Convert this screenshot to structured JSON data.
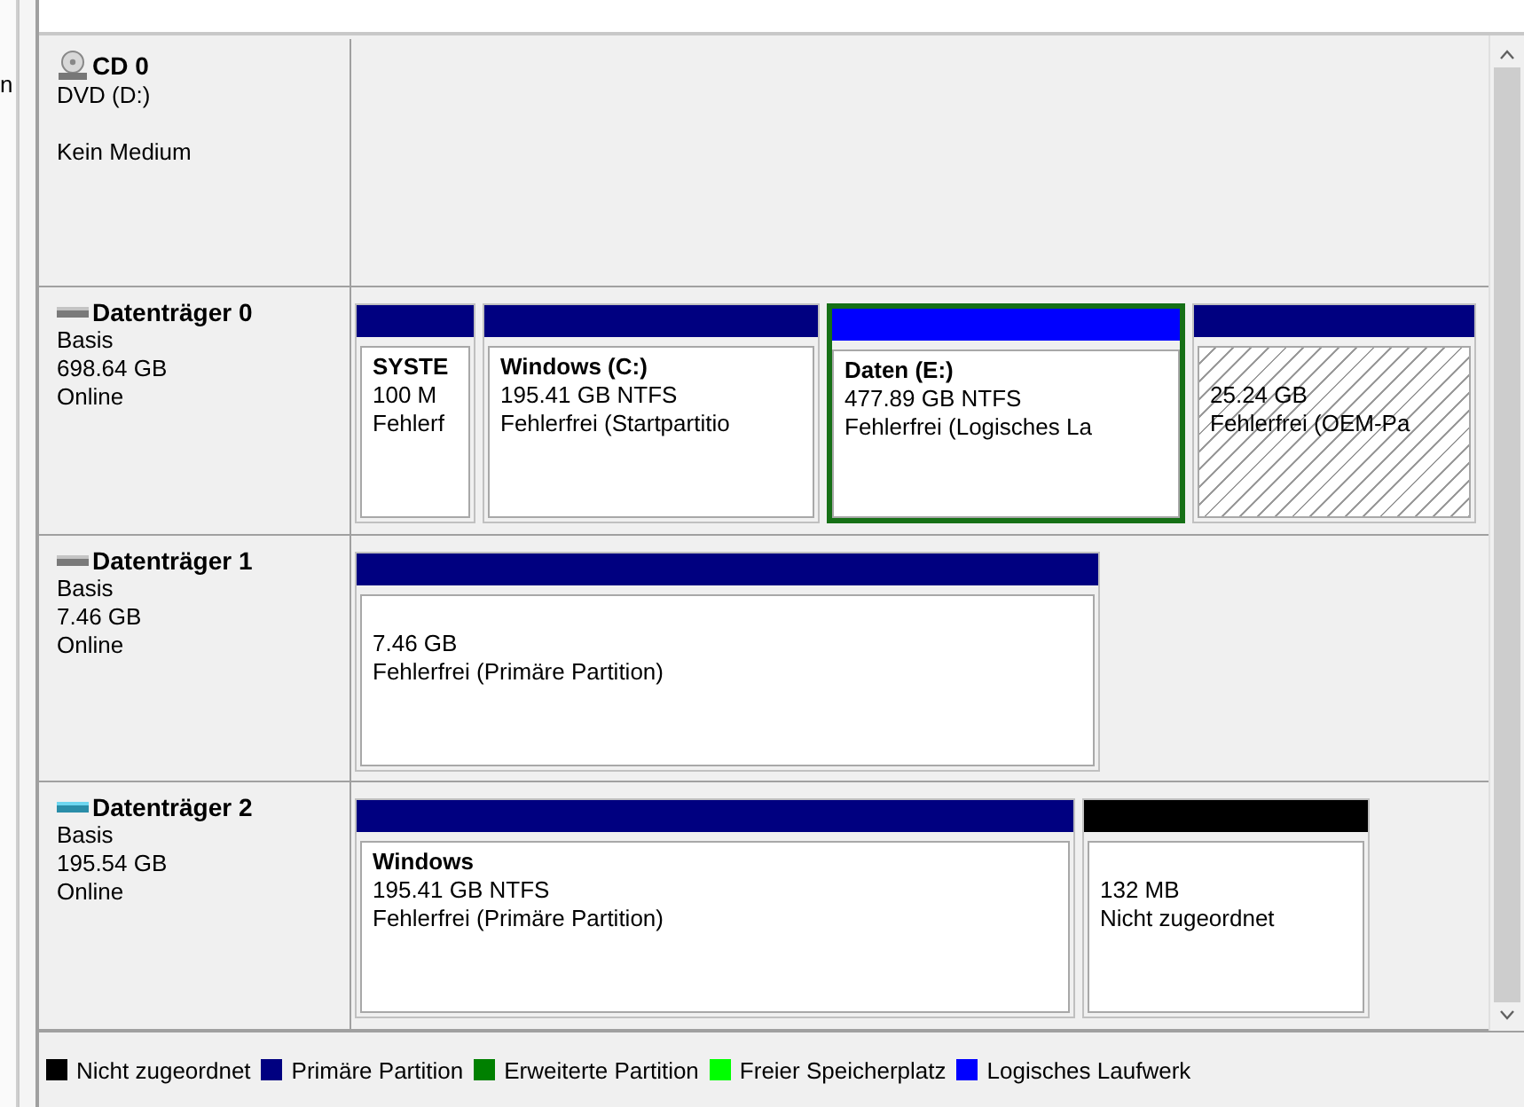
{
  "left_pane": {
    "text": "n"
  },
  "disks": [
    {
      "kind": "cdrom",
      "name": "CD 0",
      "lines": [
        "DVD (D:)",
        "Kein Medium"
      ]
    },
    {
      "kind": "disk",
      "name": "Datenträger 0",
      "lines": [
        "Basis",
        "698.64 GB",
        "Online"
      ],
      "partitions": [
        {
          "kind": "primary",
          "selected": false,
          "hatched": false,
          "title": "SYSTE",
          "size": "100 M",
          "status": "Fehlerf"
        },
        {
          "kind": "primary",
          "selected": false,
          "hatched": false,
          "title": "Windows  (C:)",
          "size": "195.41 GB NTFS",
          "status": "Fehlerfrei (Startpartitio"
        },
        {
          "kind": "logical",
          "selected": true,
          "hatched": false,
          "title": "Daten  (E:)",
          "size": "477.89 GB NTFS",
          "status": "Fehlerfrei (Logisches La"
        },
        {
          "kind": "primary",
          "selected": false,
          "hatched": true,
          "size": "25.24 GB",
          "status": "Fehlerfrei (OEM-Pa"
        }
      ]
    },
    {
      "kind": "disk",
      "name": "Datenträger 1",
      "lines": [
        "Basis",
        "7.46 GB",
        "Online"
      ],
      "partitions": [
        {
          "kind": "primary",
          "selected": false,
          "hatched": false,
          "size": "7.46 GB",
          "status": "Fehlerfrei (Primäre Partition)"
        }
      ]
    },
    {
      "kind": "virtual",
      "name": "Datenträger 2",
      "lines": [
        "Basis",
        "195.54 GB",
        "Online"
      ],
      "partitions": [
        {
          "kind": "primary",
          "selected": false,
          "hatched": false,
          "title": "Windows",
          "size": "195.41 GB NTFS",
          "status": "Fehlerfrei (Primäre Partition)"
        },
        {
          "kind": "unallocated",
          "selected": false,
          "hatched": false,
          "size": "132 MB",
          "status": "Nicht zugeordnet"
        }
      ]
    }
  ],
  "legend": [
    {
      "label": "Nicht zugeordnet",
      "color": "#000000"
    },
    {
      "label": "Primäre Partition",
      "color": "#000080"
    },
    {
      "label": "Erweiterte Partition",
      "color": "#008000"
    },
    {
      "label": "Freier Speicherplatz",
      "color": "#00ff00"
    },
    {
      "label": "Logisches Laufwerk",
      "color": "#0000ff"
    }
  ]
}
